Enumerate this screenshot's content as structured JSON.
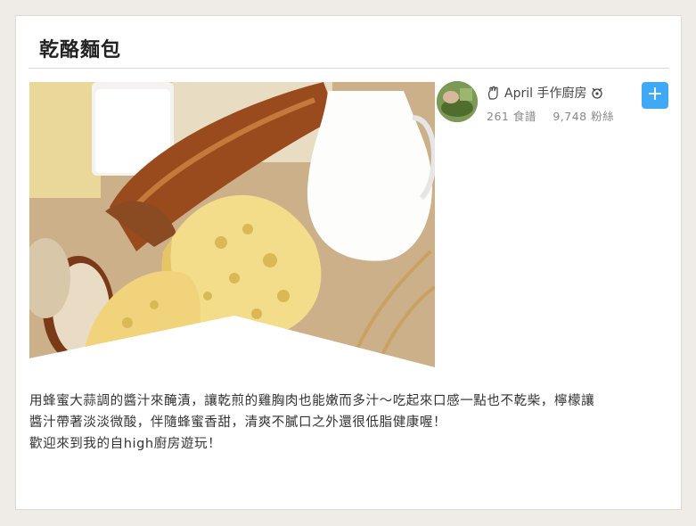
{
  "page": {
    "title": "乾酪麵包"
  },
  "photo": {
    "alt": "cheese-bread-milk-photo"
  },
  "author": {
    "name": "April 手作廚房",
    "recipes": "261 食譜",
    "followers": "9,748 粉絲",
    "left_icon": "hand-icon",
    "right_icon": "chef-icon",
    "follow_label": "+"
  },
  "description": {
    "line1": "用蜂蜜大蒜調的醬汁來醃漬，讓乾煎的雞胸肉也能嫩而多汁～吃起來口感一點也不乾柴，檸檬讓",
    "line2": "醬汁帶著淡淡微酸，伴隨蜂蜜香甜，清爽不膩口之外還很低脂健康喔！",
    "line3": "歡迎來到我的自high廚房遊玩！"
  },
  "colors": {
    "accent": "#3fa9f5",
    "background": "#efece8"
  }
}
